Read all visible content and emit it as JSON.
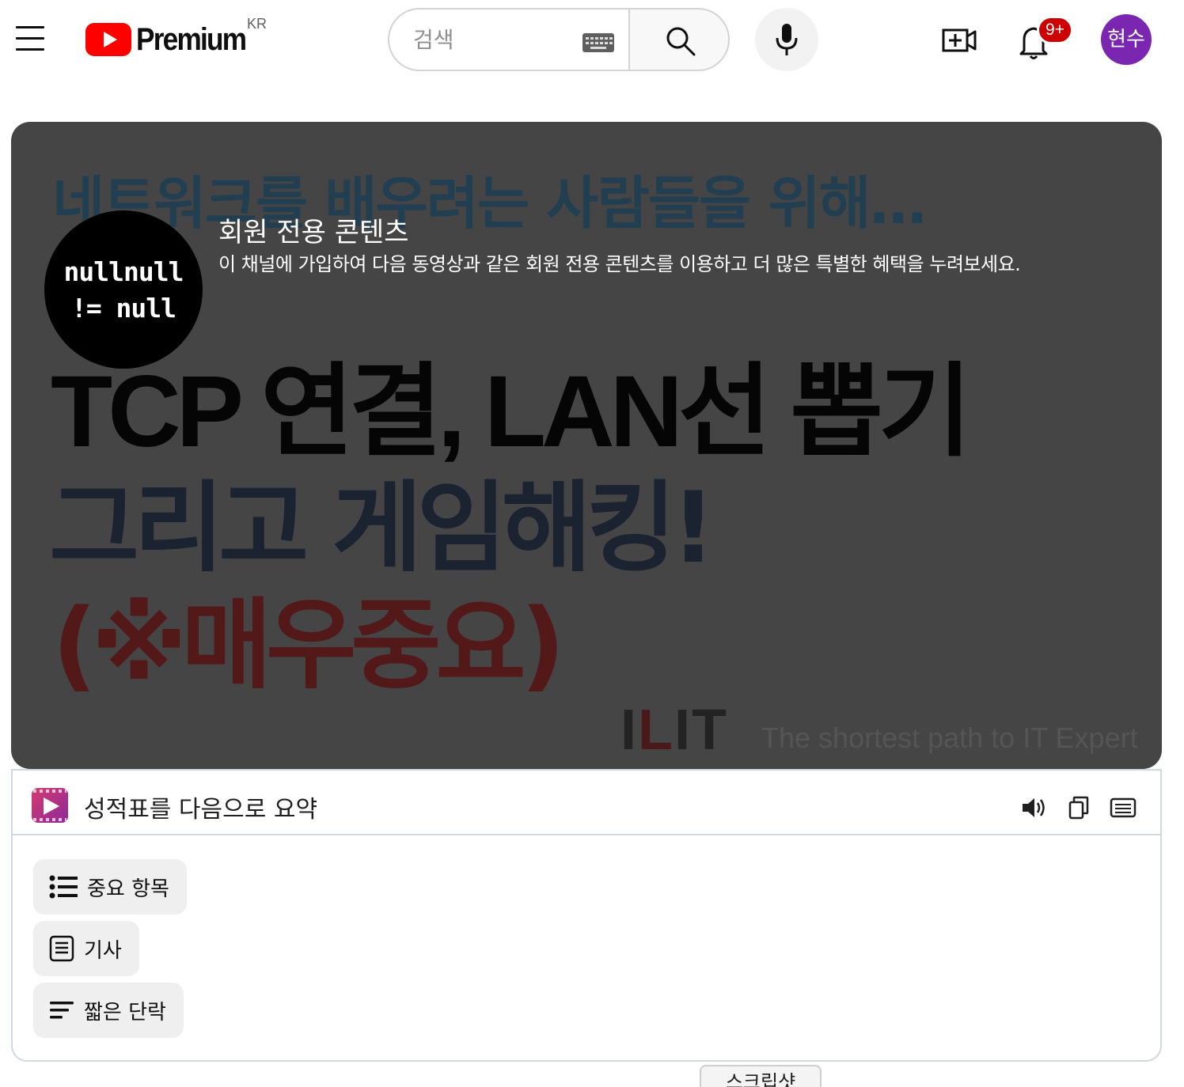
{
  "header": {
    "logo_text": "Premium",
    "country_code": "KR",
    "search_placeholder": "검색",
    "notification_count": "9+",
    "avatar_text": "현수",
    "brand_color": "#ff0000",
    "avatar_color": "#7b26b0",
    "icons": {
      "menu": "hamburger-menu-icon",
      "keyboard": "keyboard-icon",
      "search": "search-icon",
      "mic": "microphone-icon",
      "create": "create-video-icon",
      "bell": "bell-icon"
    }
  },
  "player": {
    "thumbnail_headline": "네트워크를 배우려는 사람들을 위해…",
    "thumbnail_line2": "TCP 연결, LAN선 뽑기",
    "thumbnail_line3": "그리고 게임해킹!",
    "thumbnail_line4": "(※매우중요)",
    "brand_prefix": "I",
    "brand_accent": "L",
    "brand_suffix": "IT",
    "brand_tagline": "The shortest path to IT Expert",
    "channel_logo_line1": "nullnull",
    "channel_logo_line2": "!= null",
    "members_only_title": "회원 전용 콘텐츠",
    "members_only_description": "이 채널에 가입하여 다음 동영상과 같은 회원 전용 콘텐츠를 이용하고 더 많은 특별한 혜택을 누려보세요."
  },
  "summary": {
    "title": "성적표를 다음으로 요약",
    "tools": [
      "speaker-icon",
      "copy-icon",
      "transcript-icon"
    ],
    "options": [
      {
        "label": "중요 항목",
        "icon": "bulleted-list-icon"
      },
      {
        "label": "기사",
        "icon": "document-icon"
      },
      {
        "label": "짧은 단락",
        "icon": "short-paragraph-icon"
      }
    ]
  },
  "bottom_tab": {
    "label": "스크립샷"
  }
}
